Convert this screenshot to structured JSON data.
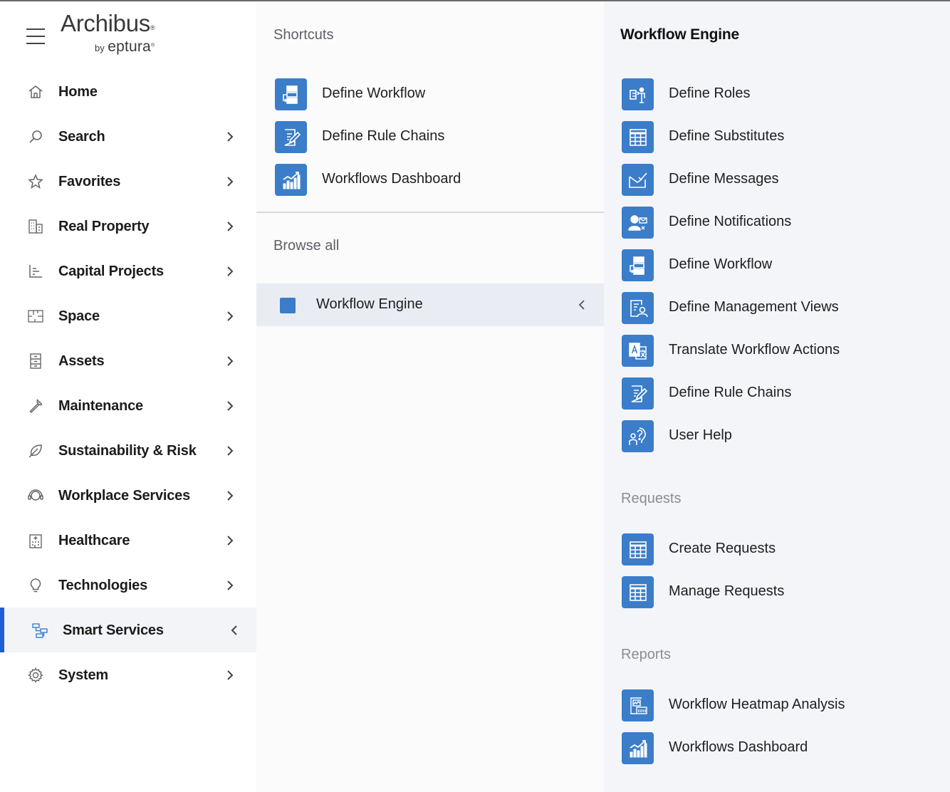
{
  "brand": {
    "name": "Archibus",
    "trademark": "®",
    "by": "by",
    "sub": "eptura",
    "sub_mark": "®"
  },
  "sidebar": {
    "items": [
      {
        "label": "Home",
        "icon": "home-icon",
        "chevron": ""
      },
      {
        "label": "Search",
        "icon": "search-icon",
        "chevron": "›"
      },
      {
        "label": "Favorites",
        "icon": "star-icon",
        "chevron": "›"
      },
      {
        "label": "Real Property",
        "icon": "building-icon",
        "chevron": "›"
      },
      {
        "label": "Capital Projects",
        "icon": "chart-icon",
        "chevron": "›"
      },
      {
        "label": "Space",
        "icon": "floorplan-icon",
        "chevron": "›"
      },
      {
        "label": "Assets",
        "icon": "cabinet-icon",
        "chevron": "›"
      },
      {
        "label": "Maintenance",
        "icon": "wrench-icon",
        "chevron": "›"
      },
      {
        "label": "Sustainability & Risk",
        "icon": "leaf-icon",
        "chevron": "›"
      },
      {
        "label": "Workplace Services",
        "icon": "headset-icon",
        "chevron": "›"
      },
      {
        "label": "Healthcare",
        "icon": "hospital-icon",
        "chevron": "›"
      },
      {
        "label": "Technologies",
        "icon": "lightbulb-icon",
        "chevron": "›"
      },
      {
        "label": "Smart Services",
        "icon": "workflow-icon",
        "chevron": "‹",
        "active": true
      },
      {
        "label": "System",
        "icon": "gear-icon",
        "chevron": "›"
      }
    ]
  },
  "middle": {
    "shortcuts_heading": "Shortcuts",
    "shortcuts": [
      {
        "label": "Define Workflow",
        "icon": "workflow-icon"
      },
      {
        "label": "Define Rule Chains",
        "icon": "edit-doc-icon"
      },
      {
        "label": "Workflows Dashboard",
        "icon": "dashboard-chart-icon"
      }
    ],
    "browse_heading": "Browse all",
    "browse_items": [
      {
        "label": "Workflow Engine",
        "selected": true
      }
    ]
  },
  "right": {
    "title": "Workflow Engine",
    "tasks": [
      {
        "label": "Define Roles",
        "icon": "roles-icon"
      },
      {
        "label": "Define Substitutes",
        "icon": "grid-icon"
      },
      {
        "label": "Define Messages",
        "icon": "envelope-check-icon"
      },
      {
        "label": "Define Notifications",
        "icon": "user-mail-icon"
      },
      {
        "label": "Define Workflow",
        "icon": "workflow-icon"
      },
      {
        "label": "Define Management Views",
        "icon": "doc-user-icon"
      },
      {
        "label": "Translate Workflow Actions",
        "icon": "translate-icon"
      },
      {
        "label": "Define Rule Chains",
        "icon": "edit-doc-icon"
      },
      {
        "label": "User Help",
        "icon": "help-icon"
      }
    ],
    "requests_heading": "Requests",
    "requests": [
      {
        "label": "Create Requests",
        "icon": "grid-icon"
      },
      {
        "label": "Manage Requests",
        "icon": "grid-icon"
      }
    ],
    "reports_heading": "Reports",
    "reports": [
      {
        "label": "Workflow Heatmap Analysis",
        "icon": "heatmap-icon"
      },
      {
        "label": "Workflows Dashboard",
        "icon": "dashboard-chart-icon"
      }
    ]
  },
  "colors": {
    "accent": "#1f5fd6",
    "tile": "#3b7dc9"
  }
}
